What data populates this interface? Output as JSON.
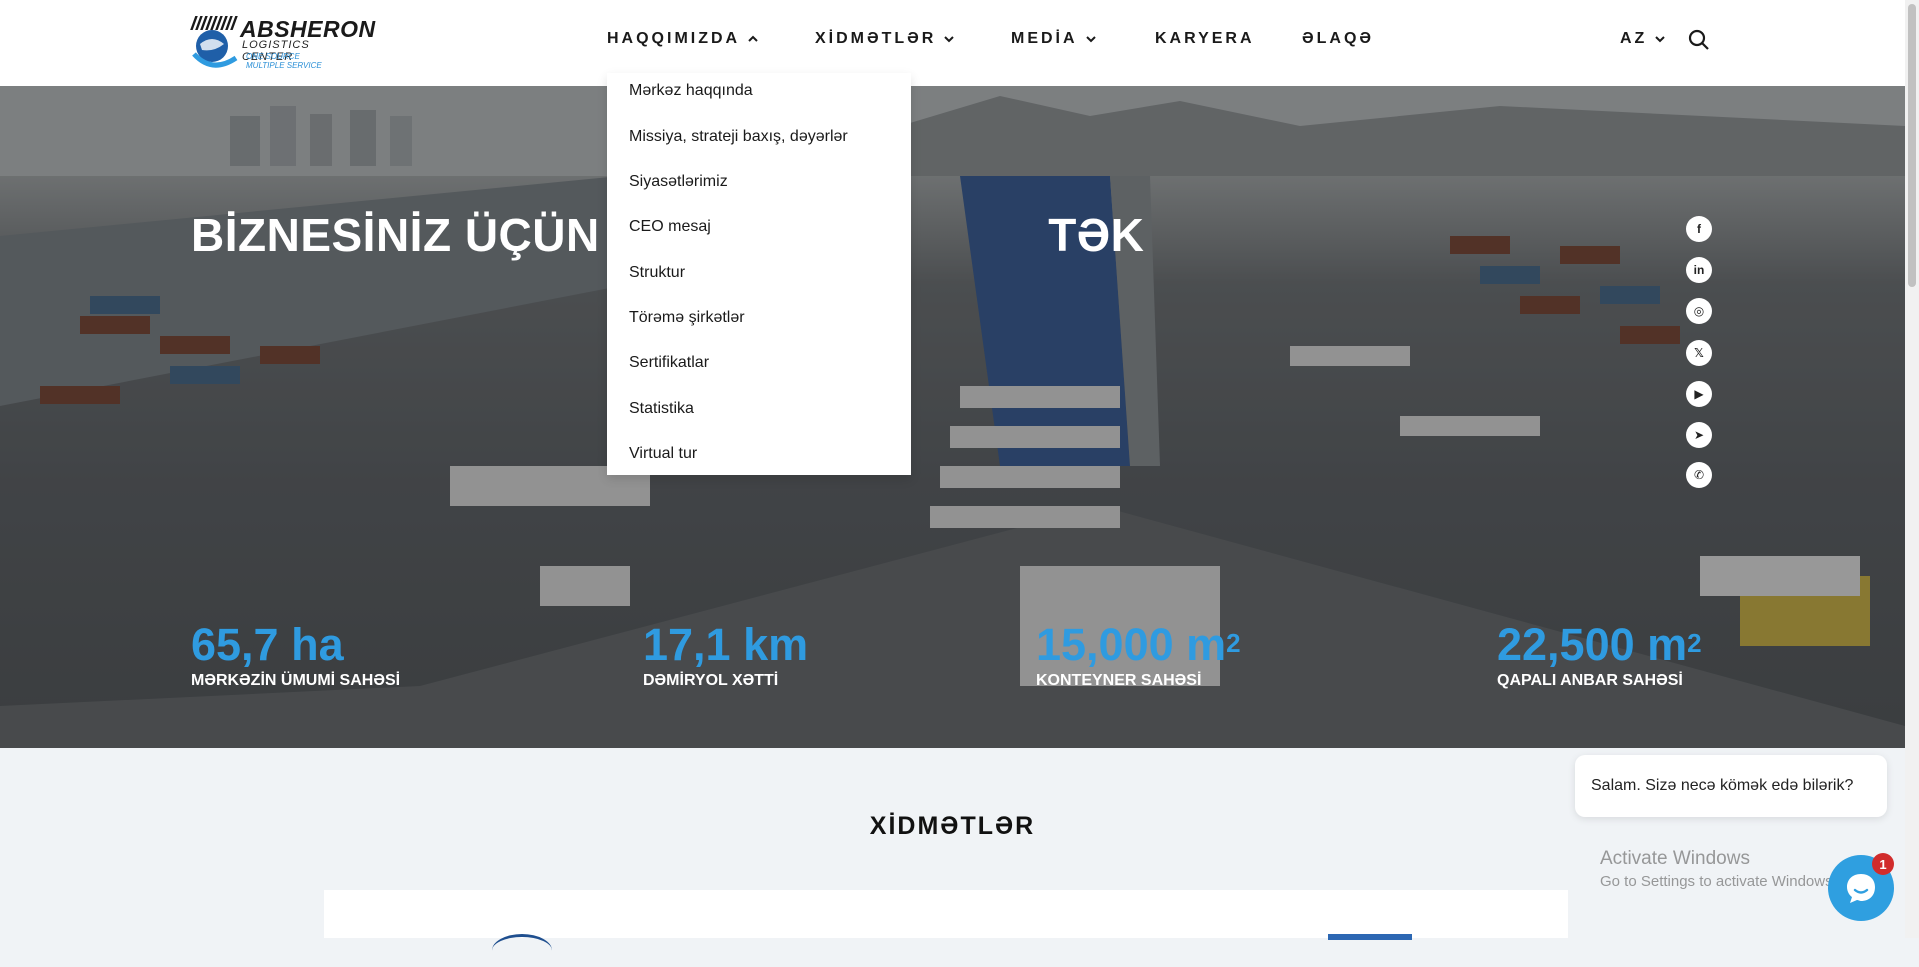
{
  "logo": {
    "name": "ABSHERON",
    "subtitle": "LOGISTICS CENTER",
    "tagline_1": "ONE SOURCE",
    "tagline_2": "MULTIPLE SERVICE"
  },
  "nav": {
    "items": [
      {
        "label": "HAQQIMIZDA",
        "icon": "chevron-up-icon",
        "expanded": true
      },
      {
        "label": "XİDMƏTLƏR",
        "icon": "chevron-down-icon"
      },
      {
        "label": "MEDİA",
        "icon": "chevron-down-icon"
      },
      {
        "label": "KARYERA"
      },
      {
        "label": "ƏLAQƏ"
      }
    ],
    "language": "AZ",
    "language_icon": "chevron-down-icon",
    "search_icon": "search-icon"
  },
  "dropdown": {
    "items": [
      "Mərkəz haqqında",
      "Missiya, strateji baxış, dəyərlər",
      "Siyasətlərimiz",
      "CEO mesaj",
      "Struktur",
      "Törəmə şirkətlər",
      "Sertifikatlar",
      "Statistika",
      "Virtual tur"
    ]
  },
  "hero": {
    "title_visible_left": "BİZNESİNİZ ÜÇÜN E",
    "title_visible_right": "TƏK",
    "stats": [
      {
        "value": "65,7 ha",
        "label": "MƏRKƏZİN ÜMUMİ SAHƏSİ"
      },
      {
        "value": "17,1 km",
        "label": "DƏMİRYOL XƏTTİ"
      },
      {
        "value": "15,000 m",
        "unit_sup": "2",
        "label": "KONTEYNER SAHƏSİ"
      },
      {
        "value": "22,500 m",
        "unit_sup": "2",
        "label": "QAPALI ANBAR SAHƏSİ"
      }
    ]
  },
  "social": [
    {
      "icon": "facebook-icon",
      "glyph": "f"
    },
    {
      "icon": "linkedin-icon",
      "glyph": "in"
    },
    {
      "icon": "instagram-icon",
      "glyph": "◎"
    },
    {
      "icon": "x-icon",
      "glyph": "𝕏"
    },
    {
      "icon": "youtube-icon",
      "glyph": "▶"
    },
    {
      "icon": "telegram-icon",
      "glyph": "➤"
    },
    {
      "icon": "whatsapp-icon",
      "glyph": "✆"
    }
  ],
  "services": {
    "title": "XİDMƏTLƏR"
  },
  "chat": {
    "greeting": "Salam. Sizə necə kömək edə bilərik?",
    "badge_count": "1"
  },
  "windows_watermark": {
    "line1": "Activate Windows",
    "line2": "Go to Settings to activate Windows."
  },
  "colors": {
    "accent_blue": "#2f9be0",
    "header_bg": "#ffffff",
    "badge_red": "#d12c2c"
  }
}
